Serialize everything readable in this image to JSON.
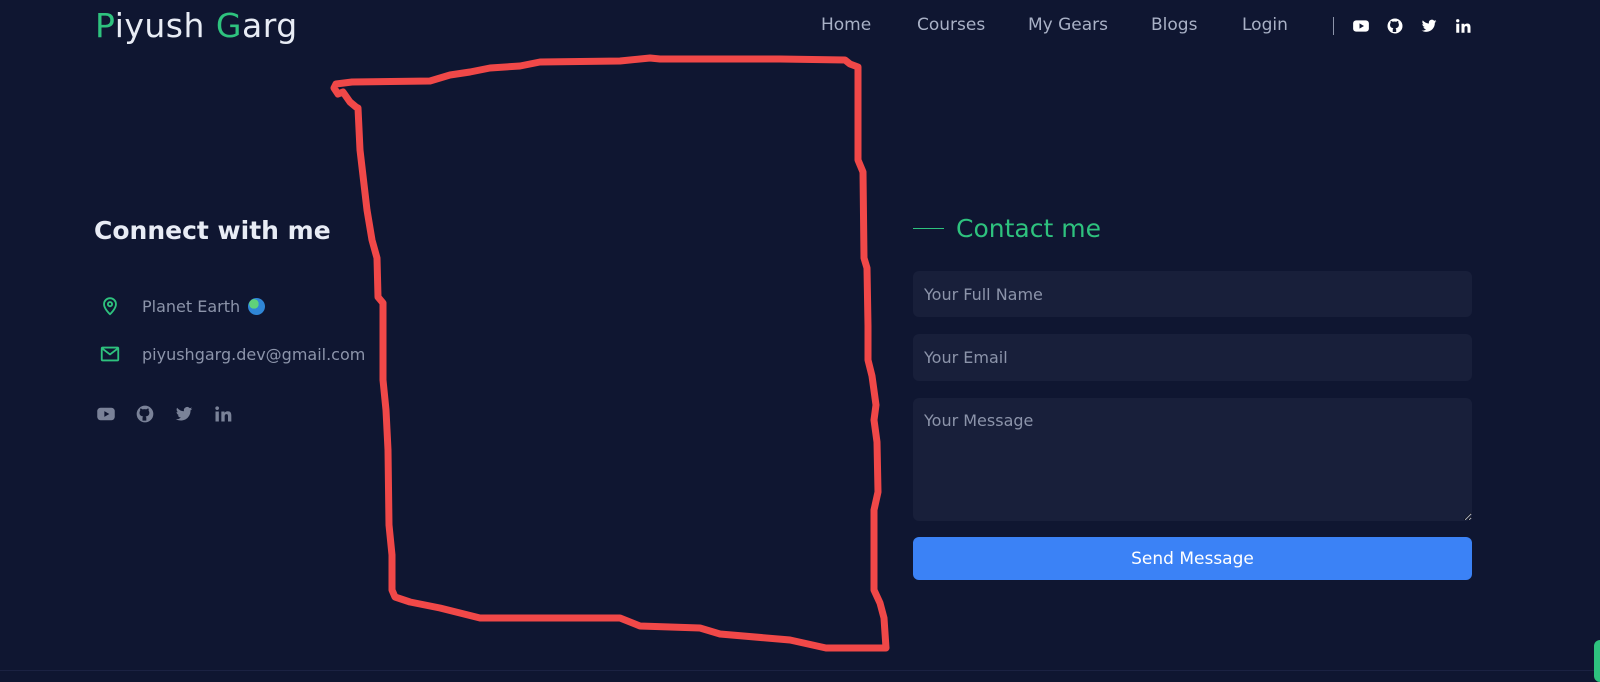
{
  "header": {
    "logo": {
      "first_initial": "P",
      "first_rest": "iyush ",
      "last_initial": "G",
      "last_rest": "arg"
    },
    "nav": [
      "Home",
      "Courses",
      "My Gears",
      "Blogs",
      "Login"
    ],
    "social_icons": [
      "youtube-icon",
      "github-icon",
      "twitter-icon",
      "linkedin-icon"
    ]
  },
  "connect": {
    "title": "Connect with me",
    "location": "Planet Earth",
    "location_emoji": "globe-emoji",
    "email": "piyushgarg.dev@gmail.com",
    "social_icons": [
      "youtube-icon",
      "github-icon",
      "twitter-icon",
      "linkedin-icon"
    ]
  },
  "contact": {
    "heading": "Contact me",
    "name_placeholder": "Your Full Name",
    "email_placeholder": "Your Email",
    "message_placeholder": "Your Message",
    "send_label": "Send Message"
  },
  "colors": {
    "background": "#0f1631",
    "accent": "#2ec27e",
    "button": "#3b82f6",
    "field": "#181f3a",
    "annotation": "#f04848"
  }
}
